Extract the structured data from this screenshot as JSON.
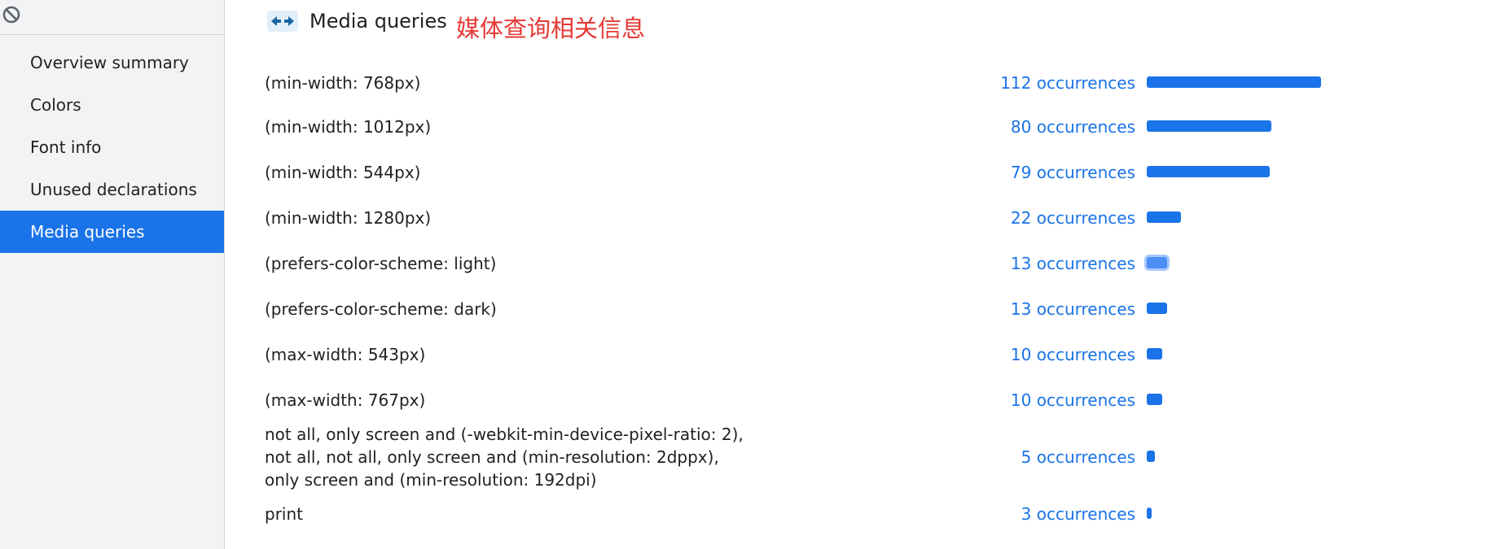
{
  "sidebar": {
    "items": [
      {
        "label": "Overview summary",
        "selected": false
      },
      {
        "label": "Colors",
        "selected": false
      },
      {
        "label": "Font info",
        "selected": false
      },
      {
        "label": "Unused declarations",
        "selected": false
      },
      {
        "label": "Media queries",
        "selected": true
      }
    ]
  },
  "header": {
    "title": "Media queries",
    "icon": "arrows-left-right-icon"
  },
  "annotation": "媒体查询相关信息",
  "colors": {
    "accent": "#1a73e8",
    "annotation": "#e53935",
    "sidebar_bg": "#f1f3f4"
  },
  "max_occurrences": 112,
  "media_queries": [
    {
      "query": "(min-width: 768px)",
      "count": 112,
      "count_label": "112 occurrences"
    },
    {
      "query": "(min-width: 1012px)",
      "count": 80,
      "count_label": "80 occurrences"
    },
    {
      "query": "(min-width: 544px)",
      "count": 79,
      "count_label": "79 occurrences"
    },
    {
      "query": "(min-width: 1280px)",
      "count": 22,
      "count_label": "22 occurrences"
    },
    {
      "query": "(prefers-color-scheme: light)",
      "count": 13,
      "count_label": "13 occurrences",
      "hovered": true
    },
    {
      "query": "(prefers-color-scheme: dark)",
      "count": 13,
      "count_label": "13 occurrences"
    },
    {
      "query": "(max-width: 543px)",
      "count": 10,
      "count_label": "10 occurrences"
    },
    {
      "query": "(max-width: 767px)",
      "count": 10,
      "count_label": "10 occurrences"
    },
    {
      "query": "not all, only screen and (-webkit-min-device-pixel-ratio: 2), not all, not all, only screen and (min-resolution: 2dppx), only screen and (min-resolution: 192dpi)",
      "count": 5,
      "count_label": "5 occurrences"
    },
    {
      "query": "print",
      "count": 3,
      "count_label": "3 occurrences"
    }
  ]
}
